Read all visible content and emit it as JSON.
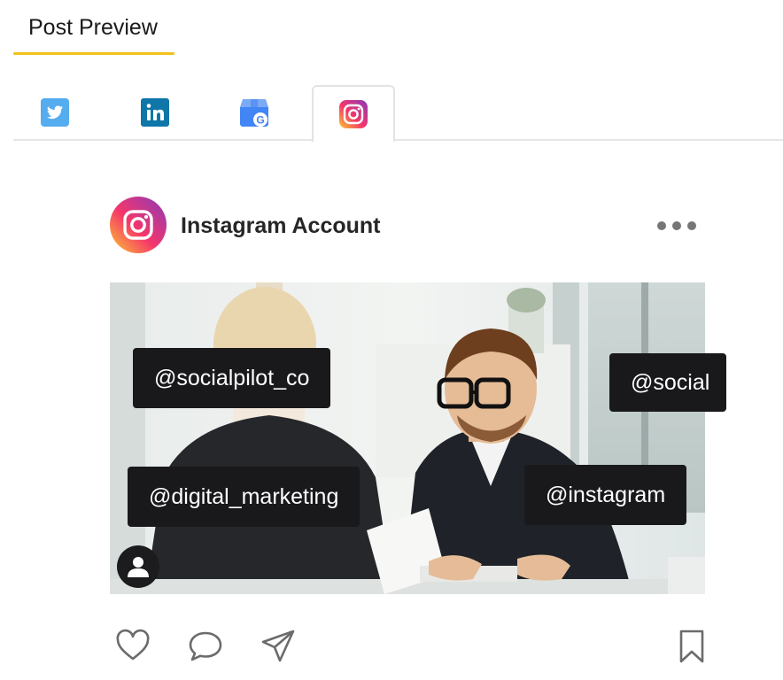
{
  "header": {
    "title": "Post Preview"
  },
  "tabs": [
    {
      "icon": "twitter-icon",
      "active": false
    },
    {
      "icon": "linkedin-icon",
      "active": false
    },
    {
      "icon": "google-business-icon",
      "active": false
    },
    {
      "icon": "instagram-icon",
      "active": true
    }
  ],
  "post": {
    "account_name": "Instagram Account",
    "tags": [
      "@socialpilot_co",
      "@social",
      "@digital_marketing",
      "@instagram"
    ],
    "actions": [
      "heart-icon",
      "comment-icon",
      "send-icon",
      "bookmark-icon"
    ]
  },
  "colors": {
    "accent_underline": "#f2c11b",
    "twitter": "#55acee",
    "linkedin": "#0e76a8",
    "tag_background": "#19191c"
  }
}
